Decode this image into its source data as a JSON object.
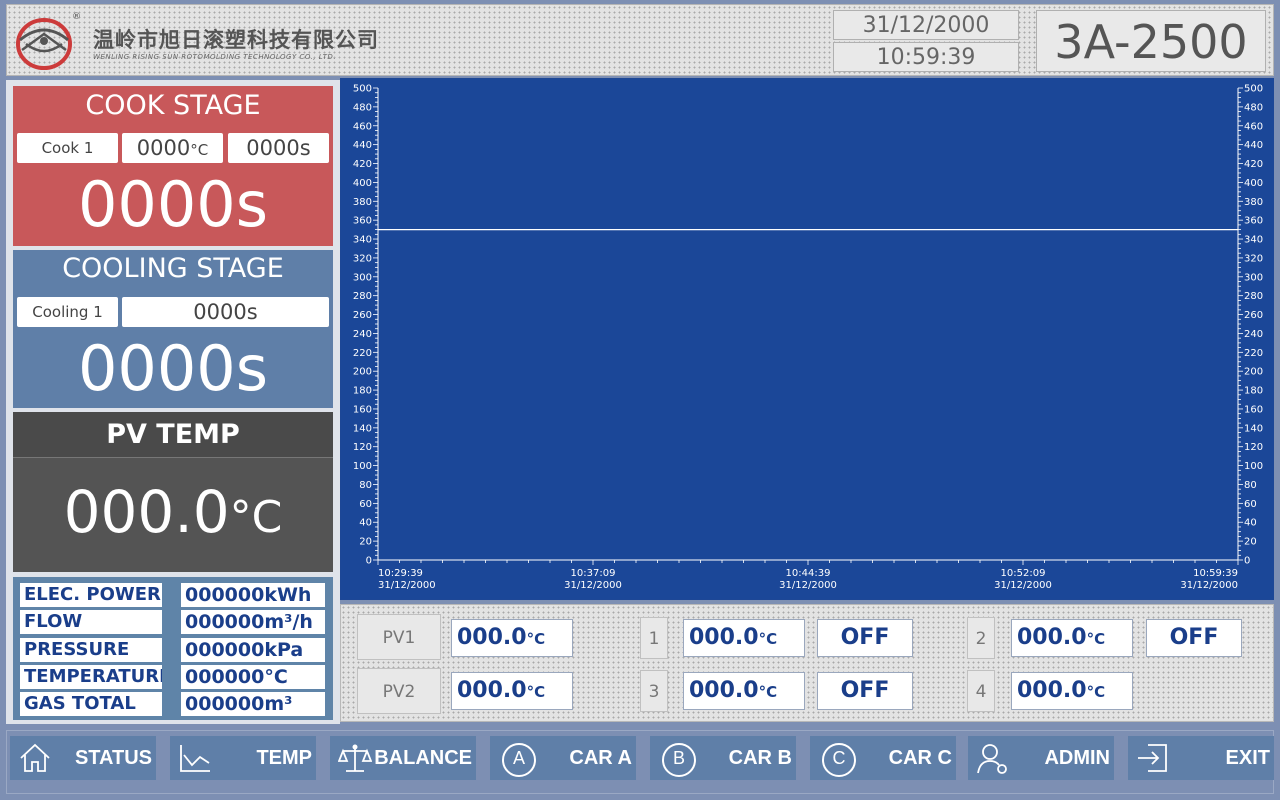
{
  "header": {
    "company_cn": "温岭市旭日滚塑科技有限公司",
    "company_en": "WENLING RISING SUN ROTOMOLDING TECHNOLOGY CO., LTD.",
    "trademark": "®",
    "date": "31/12/2000",
    "time": "10:59:39",
    "model": "3A-2500"
  },
  "cook_stage": {
    "title": "COOK STAGE",
    "step_label": "Cook 1",
    "setpoint_temp": "0000",
    "temp_unit": "°C",
    "setpoint_time": "0000s",
    "remaining": "0000s"
  },
  "cooling_stage": {
    "title": "COOLING STAGE",
    "step_label": "Cooling 1",
    "setpoint_time": "0000s",
    "remaining": "0000s"
  },
  "pv_temp": {
    "title": "PV TEMP",
    "value": "000.0",
    "unit": "°C"
  },
  "info": [
    {
      "label": "ELEC. POWER",
      "value": "000000kWh"
    },
    {
      "label": "FLOW",
      "value": "000000m³/h"
    },
    {
      "label": "PRESSURE",
      "value": "000000kPa"
    },
    {
      "label": "TEMPERATURE",
      "value": "000000°C"
    },
    {
      "label": "GAS TOTAL",
      "value": "000000m³"
    }
  ],
  "chart_data": {
    "type": "line",
    "title": "",
    "xlabel": "",
    "ylabel": "",
    "ylim": [
      0,
      500
    ],
    "y_ticks": [
      0,
      20,
      40,
      60,
      80,
      100,
      120,
      140,
      160,
      180,
      200,
      220,
      240,
      260,
      280,
      300,
      320,
      340,
      360,
      380,
      400,
      420,
      440,
      460,
      480,
      500
    ],
    "y_tick_labels": [
      "0",
      "20",
      "40",
      "60",
      "80",
      "100",
      "120",
      "140",
      "160",
      "180",
      "200",
      "220",
      "240",
      "260",
      "280",
      "300",
      "320",
      "340",
      "360",
      "380",
      "400",
      "420",
      "440",
      "460",
      "480",
      "500"
    ],
    "x_ticks": [
      {
        "time": "10:29:39",
        "date": "31/12/2000"
      },
      {
        "time": "10:37:09",
        "date": "31/12/2000"
      },
      {
        "time": "10:44:39",
        "date": "31/12/2000"
      },
      {
        "time": "10:52:09",
        "date": "31/12/2000"
      },
      {
        "time": "10:59:39",
        "date": "31/12/2000"
      }
    ],
    "series": [
      {
        "x": [
          "10:29:39",
          "10:59:39"
        ],
        "values": [
          350,
          350
        ],
        "color": "#ffffff"
      }
    ],
    "background": "#1b4798",
    "grid": false,
    "right_axis": true
  },
  "readings": {
    "temp_unit": "°C",
    "pv1": {
      "label": "PV1",
      "value": "000.0"
    },
    "pv2": {
      "label": "PV2",
      "value": "000.0"
    },
    "zones": [
      {
        "num": "1",
        "value": "000.0",
        "state": "OFF"
      },
      {
        "num": "2",
        "value": "000.0",
        "state": "OFF"
      },
      {
        "num": "3",
        "value": "000.0",
        "state": "OFF"
      },
      {
        "num": "4",
        "value": "000.0",
        "state": ""
      }
    ]
  },
  "nav": [
    {
      "label": "STATUS",
      "icon": "home-icon"
    },
    {
      "label": "TEMP",
      "icon": "trend-chart-icon"
    },
    {
      "label": "BALANCE",
      "icon": "balance-icon"
    },
    {
      "label": "CAR A",
      "icon": "circle-a-icon",
      "glyph": "A"
    },
    {
      "label": "CAR B",
      "icon": "circle-b-icon",
      "glyph": "B"
    },
    {
      "label": "CAR C",
      "icon": "circle-c-icon",
      "glyph": "C"
    },
    {
      "label": "ADMIN",
      "icon": "user-gear-icon"
    },
    {
      "label": "EXIT",
      "icon": "exit-icon"
    }
  ],
  "colors": {
    "cook": "#c8585a",
    "cooling": "#5f7fa8",
    "pv": "#545454",
    "chart_bg": "#1b4798",
    "value_text": "#1a3e8a"
  }
}
